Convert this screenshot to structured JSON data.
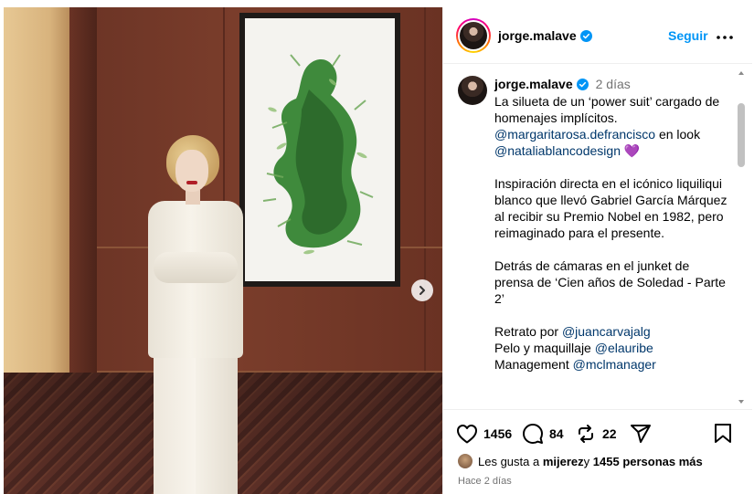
{
  "post": {
    "username": "jorge.malave",
    "follow_label": "Seguir",
    "more_label": "Más opciones"
  },
  "caption": {
    "username": "jorge.malave",
    "time": "2 días",
    "line1": "La silueta de un ‘power suit’ cargado de homenajes implícitos.",
    "mention1": "@margaritarosa.defrancisco",
    "mid_text": " en look ",
    "mention2": "@nataliablancodesign",
    "heart": "💜",
    "para2": "Inspiración directa en el icónico liquiliqui blanco que llevó Gabriel García Márquez al recibir su Premio Nobel en 1982, pero reimaginado para el presente.",
    "para3": "Detrás de cámaras en el junket de prensa de ‘Cien años de Soledad - Parte 2’",
    "credit1_text": "Retrato por ",
    "credit1_mention": "@juancarvajalg",
    "credit2_text": "Pelo y maquillaje ",
    "credit2_mention": "@elauribe",
    "credit3_text": "Management ",
    "credit3_mention": "@mclmanager"
  },
  "actions": {
    "likes_count": "1456",
    "comments_count": "84",
    "reposts_count": "22",
    "liked_by_prefix": "Les gusta a ",
    "liked_by_user": "mijerez",
    "liked_by_mid": " y ",
    "liked_by_others": "1455 personas más",
    "time_ago": "Hace 2 días"
  },
  "colors": {
    "link": "#00376b",
    "follow": "#0095f6",
    "verified": "#0095f6",
    "muted": "#737373"
  },
  "icons": [
    "verified-badge-icon",
    "more-icon",
    "next-arrow-icon",
    "heart-icon",
    "comment-icon",
    "repost-icon",
    "share-icon",
    "save-icon"
  ]
}
